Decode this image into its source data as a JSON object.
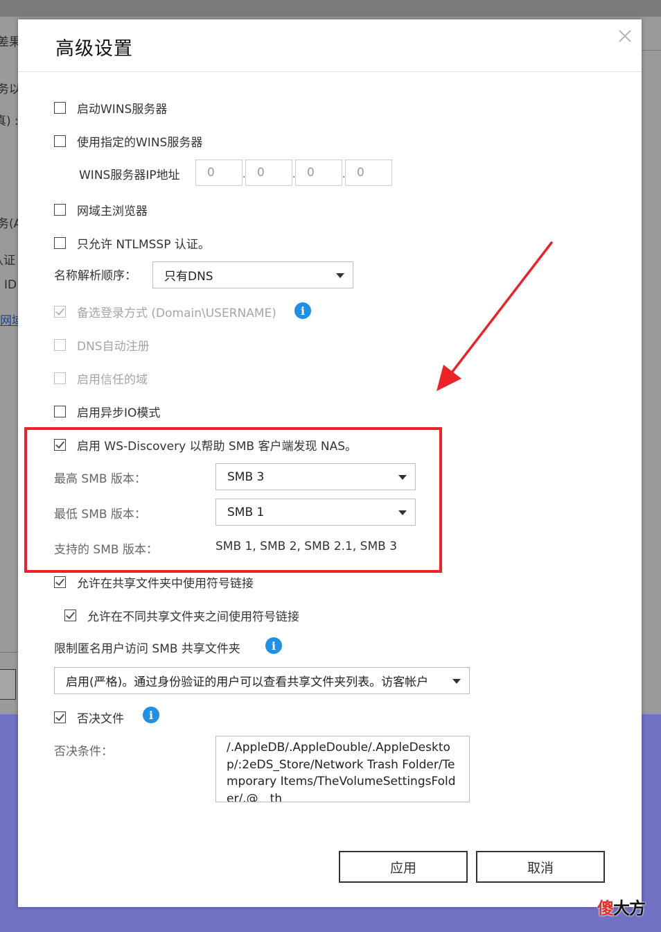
{
  "background": {
    "fragments": [
      "差果",
      "务以",
      "真) :",
      "务(A",
      "认证",
      "ID",
      "网域"
    ]
  },
  "dialog": {
    "title": "高级设置",
    "wins_server": {
      "label": "启动WINS服务器",
      "checked": false
    },
    "use_wins": {
      "label": "使用指定的WINS服务器",
      "checked": false
    },
    "wins_ip": {
      "label": "WINS服务器IP地址",
      "octets": [
        "0",
        "0",
        "0",
        "0"
      ],
      "separator": "."
    },
    "domain_browser": {
      "label": "网域主浏览器",
      "checked": false
    },
    "ntlmssp": {
      "label": "只允许 NTLMSSP 认证。",
      "checked": false
    },
    "name_resolution": {
      "label": "名称解析顺序：",
      "value": "只有DNS"
    },
    "alt_login": {
      "label": "备选登录方式 (Domain\\USERNAME)",
      "checked": true,
      "disabled": true
    },
    "dns_register": {
      "label": "DNS自动注册",
      "checked": false,
      "disabled": true
    },
    "trusted_domain": {
      "label": "启用信任的域",
      "checked": false,
      "disabled": true
    },
    "async_io": {
      "label": "启用异步IO模式",
      "checked": false
    },
    "ws_discovery": {
      "label": "启用 WS-Discovery 以帮助 SMB 客户端发现 NAS。",
      "checked": true
    },
    "max_smb": {
      "label": "最高 SMB 版本：",
      "value": "SMB 3"
    },
    "min_smb": {
      "label": "最低 SMB 版本：",
      "value": "SMB 1"
    },
    "supported_smb": {
      "label": "支持的 SMB 版本：",
      "value": "SMB 1, SMB 2, SMB 2.1, SMB 3"
    },
    "symlinks": {
      "label": "允许在共享文件夹中使用符号链接",
      "checked": true
    },
    "cross_symlinks": {
      "label": "允许在不同共享文件夹之间使用符号链接",
      "checked": true
    },
    "anon_access": {
      "label": "限制匿名用户访问 SMB 共享文件夹",
      "value": "启用(严格)。通过身份验证的用户可以查看共享文件夹列表。访客帐户"
    },
    "veto_files": {
      "label": "否决文件",
      "checked": true
    },
    "veto_condition": {
      "label": "否决条件：",
      "value": "/.AppleDB/.AppleDouble/.AppleDesktop/:2eDS_Store/Network Trash Folder/Temporary Items/TheVolumeSettingsFolder/.@__th"
    },
    "apply_label": "应用",
    "cancel_label": "取消"
  },
  "annotation": {
    "color": "#ec2226"
  },
  "watermark": {
    "part1": "傻",
    "part2": "大方"
  },
  "colors": {
    "info_icon": "#1e90e6",
    "background_purple": "#7272c4"
  }
}
